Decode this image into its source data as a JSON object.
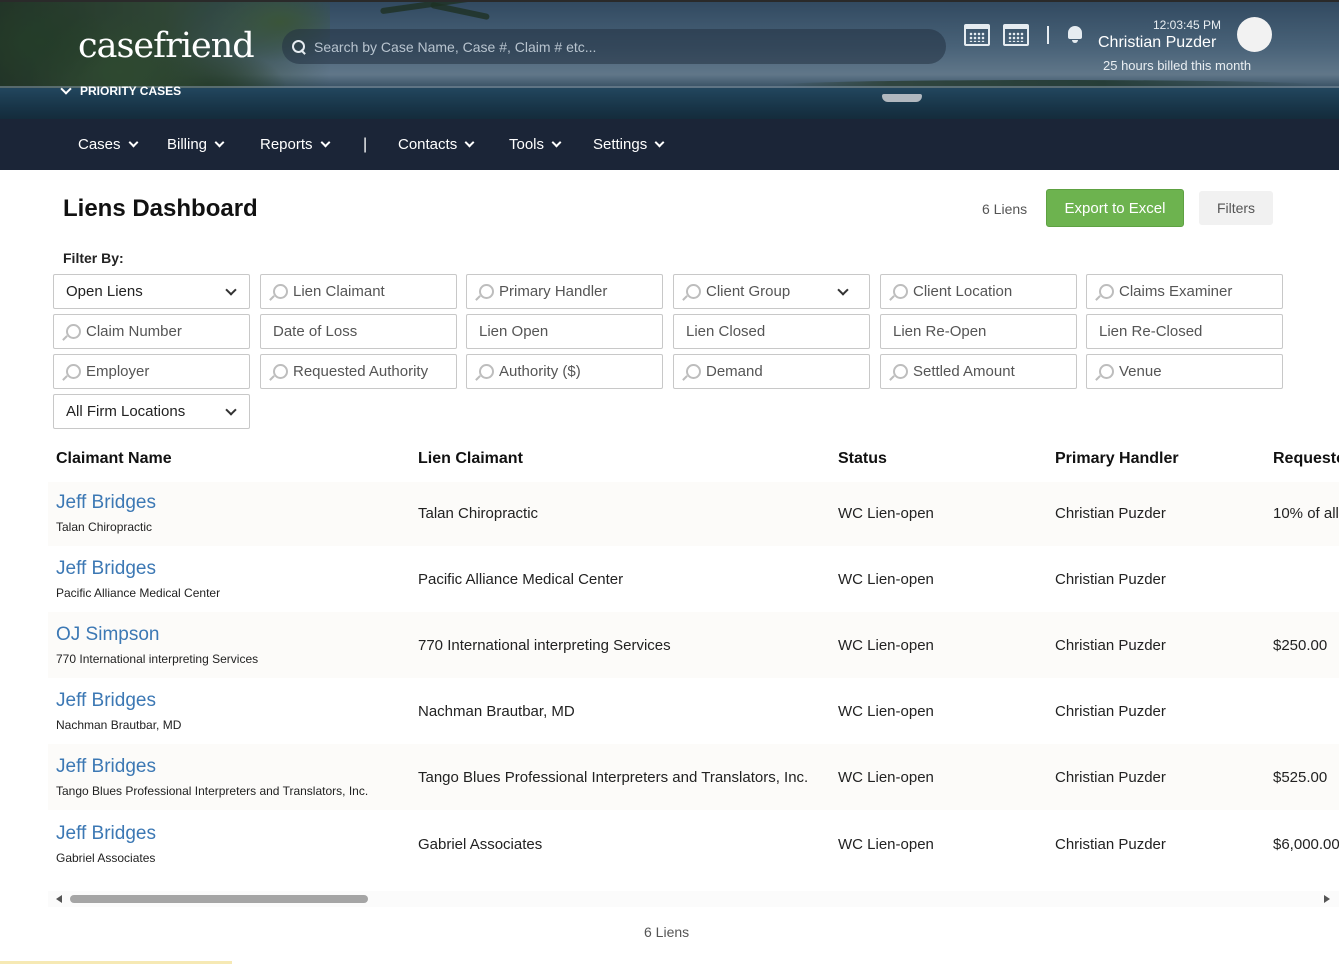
{
  "header": {
    "logo": "casefriend",
    "priority_label": "PRIORITY CASES",
    "search_placeholder": "Search by Case Name, Case #, Claim # etc...",
    "clock": "12:03:45 PM",
    "user_name": "Christian Puzder",
    "billed": "25 hours billed this month"
  },
  "nav": {
    "items": [
      {
        "label": "Cases"
      },
      {
        "label": "Billing"
      },
      {
        "label": "Reports"
      },
      {
        "label": "Contacts"
      },
      {
        "label": "Tools"
      },
      {
        "label": "Settings"
      }
    ],
    "separator": "|"
  },
  "page": {
    "title": "Liens Dashboard",
    "count_top": "6 Liens",
    "export_label": "Export to Excel",
    "filters_label": "Filters",
    "filter_by": "Filter By:",
    "count_bottom": "6 Liens"
  },
  "filters": {
    "status_select": "Open Liens",
    "lien_claimant": "Lien Claimant",
    "primary_handler": "Primary Handler",
    "client_group": "Client Group",
    "client_location": "Client Location",
    "claims_examiner": "Claims Examiner",
    "claim_number": "Claim Number",
    "date_of_loss": "Date of Loss",
    "lien_open": "Lien Open",
    "lien_closed": "Lien Closed",
    "lien_reopen": "Lien Re-Open",
    "lien_reclosed": "Lien Re-Closed",
    "employer": "Employer",
    "requested_authority": "Requested Authority",
    "authority": "Authority ($)",
    "demand": "Demand",
    "settled_amount": "Settled Amount",
    "venue": "Venue",
    "firm_locations": "All Firm Locations"
  },
  "table": {
    "columns": [
      "Claimant Name",
      "Lien Claimant",
      "Status",
      "Primary Handler",
      "Requested"
    ],
    "rows": [
      {
        "name": "Jeff Bridges",
        "sub": "Talan Chiropractic",
        "claimant": "Talan Chiropractic",
        "status": "WC Lien-open",
        "handler": "Christian Puzder",
        "requested": "10% of all"
      },
      {
        "name": "Jeff Bridges",
        "sub": "Pacific Alliance Medical Center",
        "claimant": "Pacific Alliance Medical Center",
        "status": "WC Lien-open",
        "handler": "Christian Puzder",
        "requested": ""
      },
      {
        "name": "OJ Simpson",
        "sub": "770 International interpreting Services",
        "claimant": "770 International interpreting Services",
        "status": "WC Lien-open",
        "handler": "Christian Puzder",
        "requested": "$250.00"
      },
      {
        "name": "Jeff Bridges",
        "sub": "Nachman Brautbar, MD",
        "claimant": "Nachman Brautbar, MD",
        "status": "WC Lien-open",
        "handler": "Christian Puzder",
        "requested": ""
      },
      {
        "name": "Jeff Bridges",
        "sub": "Tango Blues Professional Interpreters and Translators, Inc.",
        "claimant": "Tango Blues Professional Interpreters and Translators, Inc.",
        "status": "WC Lien-open",
        "handler": "Christian Puzder",
        "requested": "$525.00"
      },
      {
        "name": "Jeff Bridges",
        "sub": "Gabriel Associates",
        "claimant": "Gabriel Associates",
        "status": "WC Lien-open",
        "handler": "Christian Puzder",
        "requested": "$6,000.00"
      }
    ]
  },
  "colors": {
    "nav_bg": "#1b2537",
    "accent_green": "#6db34f",
    "link_blue": "#3c78b4"
  }
}
